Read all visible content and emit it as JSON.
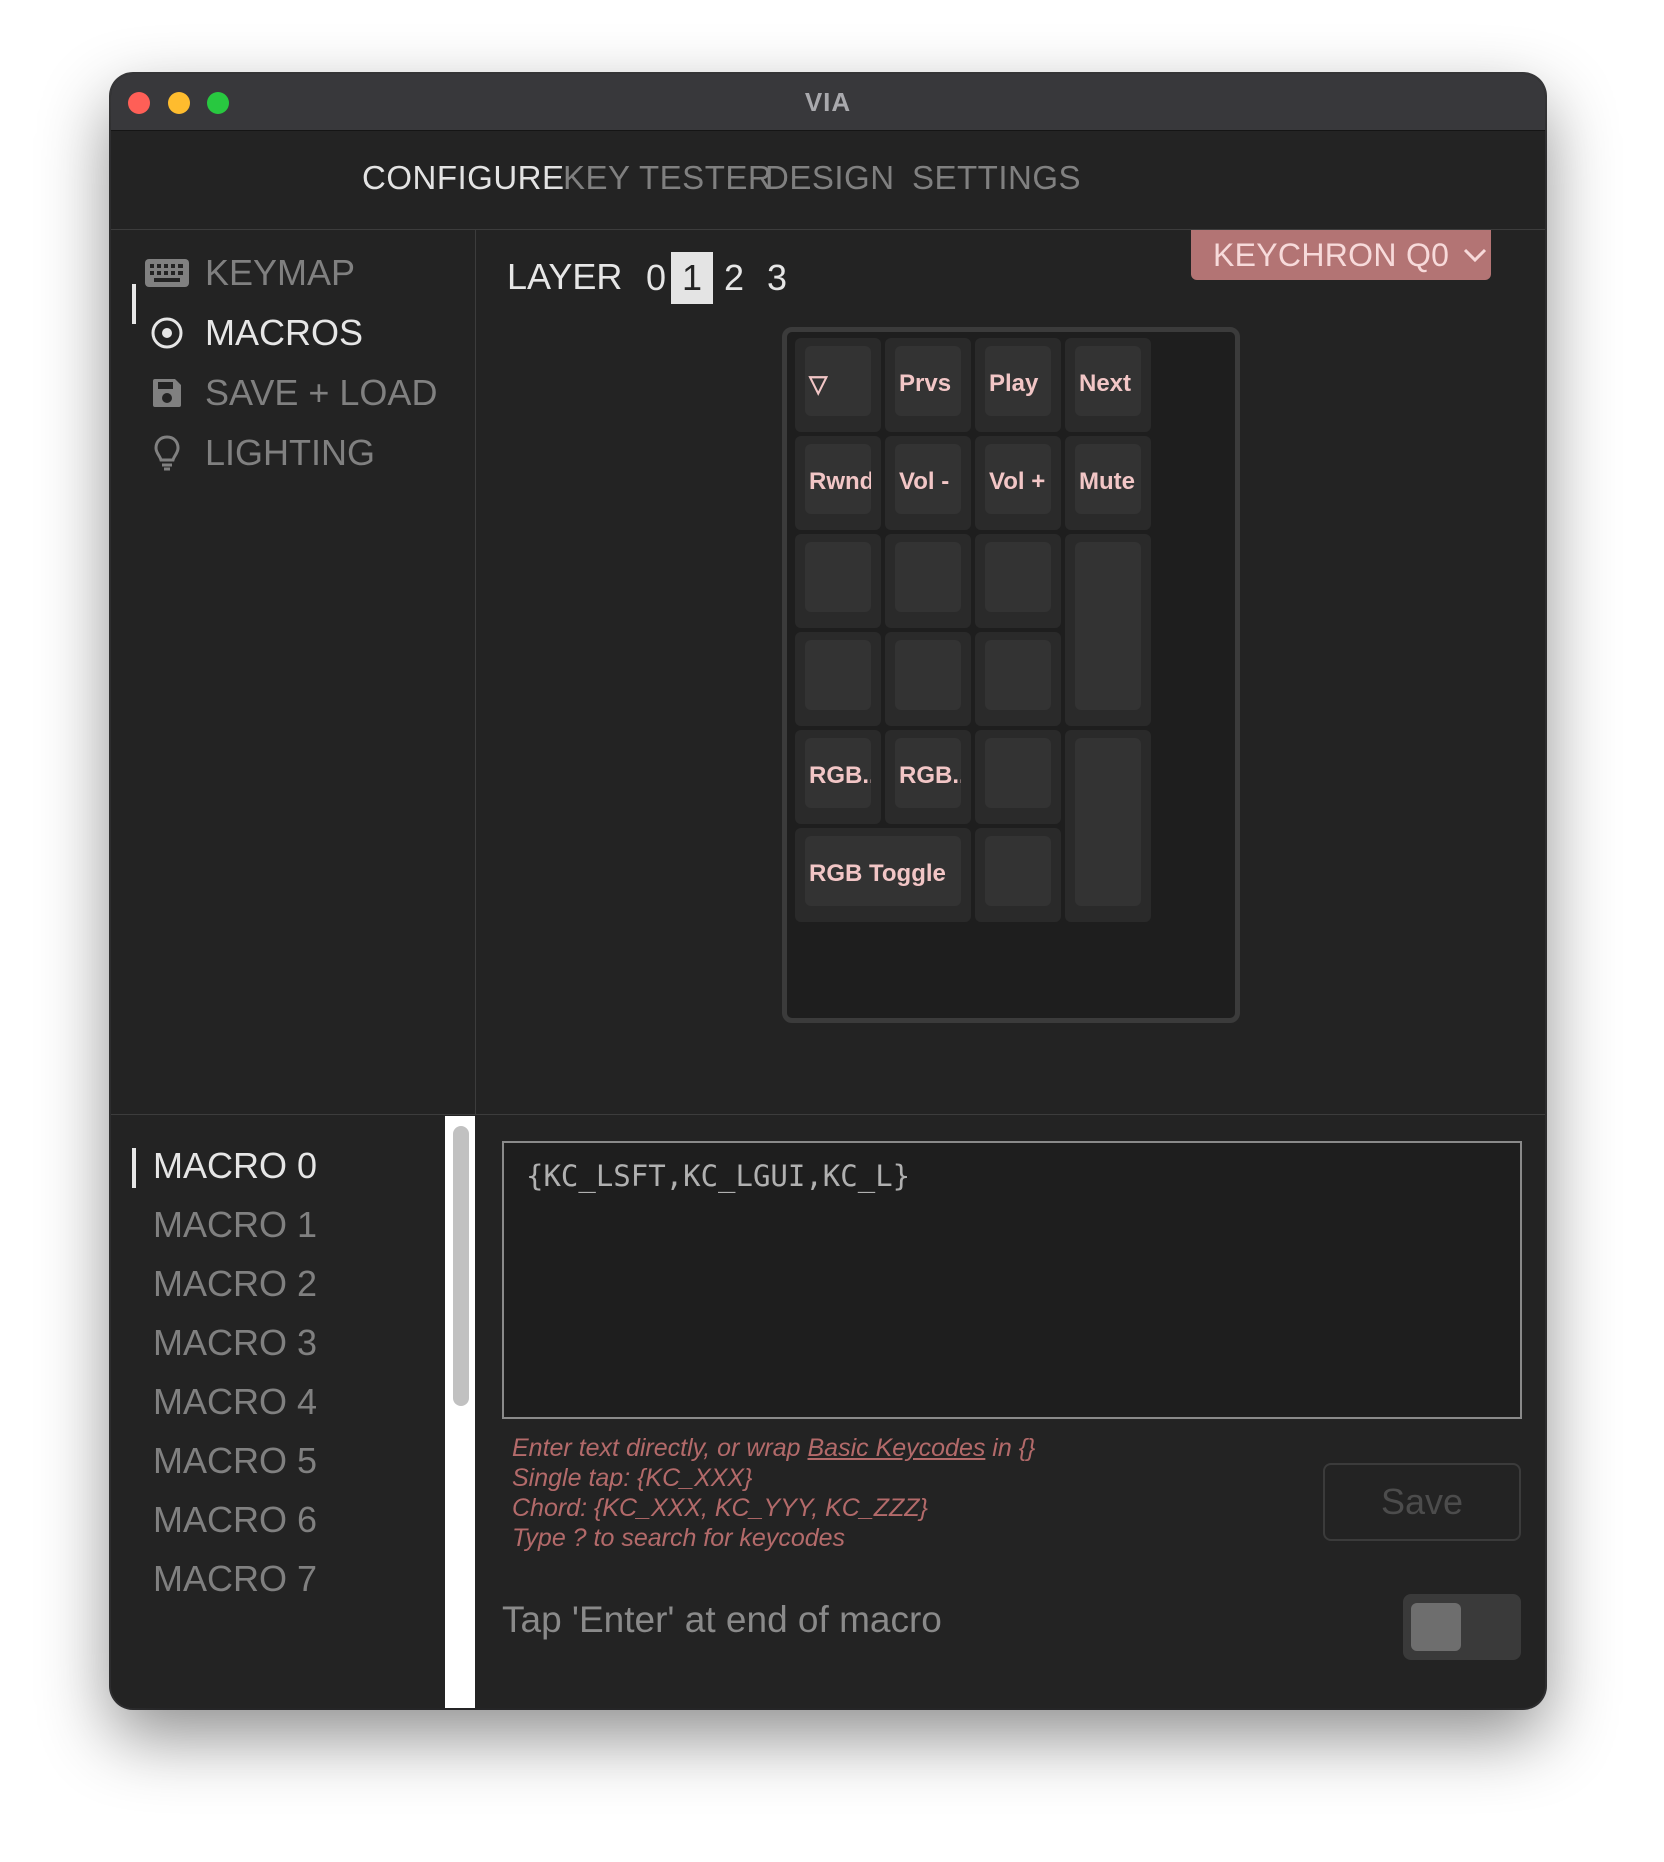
{
  "window": {
    "title": "VIA"
  },
  "nav": {
    "tabs": [
      {
        "label": "CONFIGURE",
        "active": true
      },
      {
        "label": "KEY TESTER",
        "active": false
      },
      {
        "label": "DESIGN",
        "active": false
      },
      {
        "label": "SETTINGS",
        "active": false
      }
    ]
  },
  "menu": {
    "items": [
      {
        "label": "KEYMAP",
        "icon": "keyboard-icon",
        "active": false
      },
      {
        "label": "MACROS",
        "icon": "target-icon",
        "active": true
      },
      {
        "label": "SAVE + LOAD",
        "icon": "floppy-disk-icon",
        "active": false
      },
      {
        "label": "LIGHTING",
        "icon": "lightbulb-icon",
        "active": false
      }
    ]
  },
  "layer": {
    "label": "LAYER",
    "options": [
      "0",
      "1",
      "2",
      "3"
    ],
    "selected": "1"
  },
  "device": {
    "name": "KEYCHRON Q0"
  },
  "keys": [
    "▽",
    "Prvs",
    "Play",
    "Next",
    "Rwnd",
    "Vol -",
    "Vol +",
    "Mute",
    "",
    "",
    "",
    "",
    "",
    "",
    "",
    "",
    "RGB...",
    "RGB...",
    "",
    "",
    "RGB Toggle",
    ""
  ],
  "macros": {
    "items": [
      "MACRO 0",
      "MACRO 1",
      "MACRO 2",
      "MACRO 3",
      "MACRO 4",
      "MACRO 5",
      "MACRO 6",
      "MACRO 7"
    ],
    "selected": "MACRO 0"
  },
  "editor": {
    "value": "{KC_LSFT,KC_LGUI,KC_L}",
    "help_prefix": "Enter text directly, or wrap ",
    "help_link": "Basic Keycodes",
    "help_suffix": " in {}",
    "single_tap": "Single tap: {KC_XXX}",
    "chord": "Chord: {KC_XXX, KC_YYY, KC_ZZZ}",
    "search": "Type ? to search for keycodes",
    "save_label": "Save",
    "tap_enter_label": "Tap 'Enter' at end of macro",
    "tap_enter_on": false
  },
  "colors": {
    "accent": "#b37474",
    "accent_text": "#f2c6c6",
    "help_text": "#b36a6a"
  }
}
